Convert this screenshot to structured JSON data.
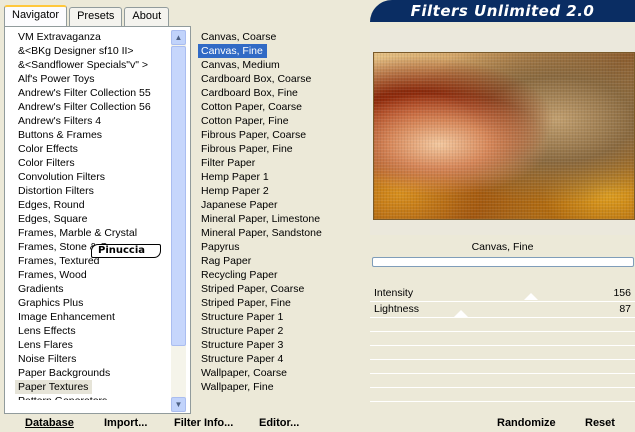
{
  "tabs": [
    {
      "label": "Navigator",
      "active": true
    },
    {
      "label": "Presets",
      "active": false
    },
    {
      "label": "About",
      "active": false
    }
  ],
  "banner_title": "Filters Unlimited 2.0",
  "categories": [
    "VM Extravaganza",
    "&<BKg Designer sf10 II>",
    "&<Sandflower Specials\"v\" >",
    "Alf's Power Toys",
    "Andrew's Filter Collection 55",
    "Andrew's Filter Collection 56",
    "Andrew's Filters 4",
    "Buttons & Frames",
    "Color Effects",
    "Color Filters",
    "Convolution Filters",
    "Distortion Filters",
    "Edges, Round",
    "Edges, Square",
    "Frames, Marble & Crystal",
    "Frames, Stone & C",
    "Frames, Textured",
    "Frames, Wood",
    "Gradients",
    "Graphics Plus",
    "Image Enhancement",
    "Lens Effects",
    "Lens Flares",
    "Noise Filters",
    "Paper Backgrounds",
    "Paper Textures",
    "Pattern Generators"
  ],
  "selected_category_index": 25,
  "filters": [
    "Canvas, Coarse",
    "Canvas, Fine",
    "Canvas, Medium",
    "Cardboard Box, Coarse",
    "Cardboard Box, Fine",
    "Cotton Paper, Coarse",
    "Cotton Paper, Fine",
    "Fibrous Paper, Coarse",
    "Fibrous Paper, Fine",
    "Filter Paper",
    "Hemp Paper 1",
    "Hemp Paper 2",
    "Japanese Paper",
    "Mineral Paper, Limestone",
    "Mineral Paper, Sandstone",
    "Papyrus",
    "Rag Paper",
    "Recycling Paper",
    "Striped Paper, Coarse",
    "Striped Paper, Fine",
    "Structure Paper 1",
    "Structure Paper 2",
    "Structure Paper 3",
    "Structure Paper 4",
    "Wallpaper, Coarse",
    "Wallpaper, Fine"
  ],
  "selected_filter_index": 1,
  "watermark_text": "Pinuccia",
  "preview": {
    "filter_name": "Canvas, Fine"
  },
  "params": [
    {
      "label": "Intensity",
      "value": "156"
    },
    {
      "label": "Lightness",
      "value": "87"
    }
  ],
  "buttons": {
    "database": "Database",
    "import": "Import...",
    "filter_info": "Filter Info...",
    "editor": "Editor...",
    "randomize": "Randomize",
    "reset": "Reset"
  }
}
